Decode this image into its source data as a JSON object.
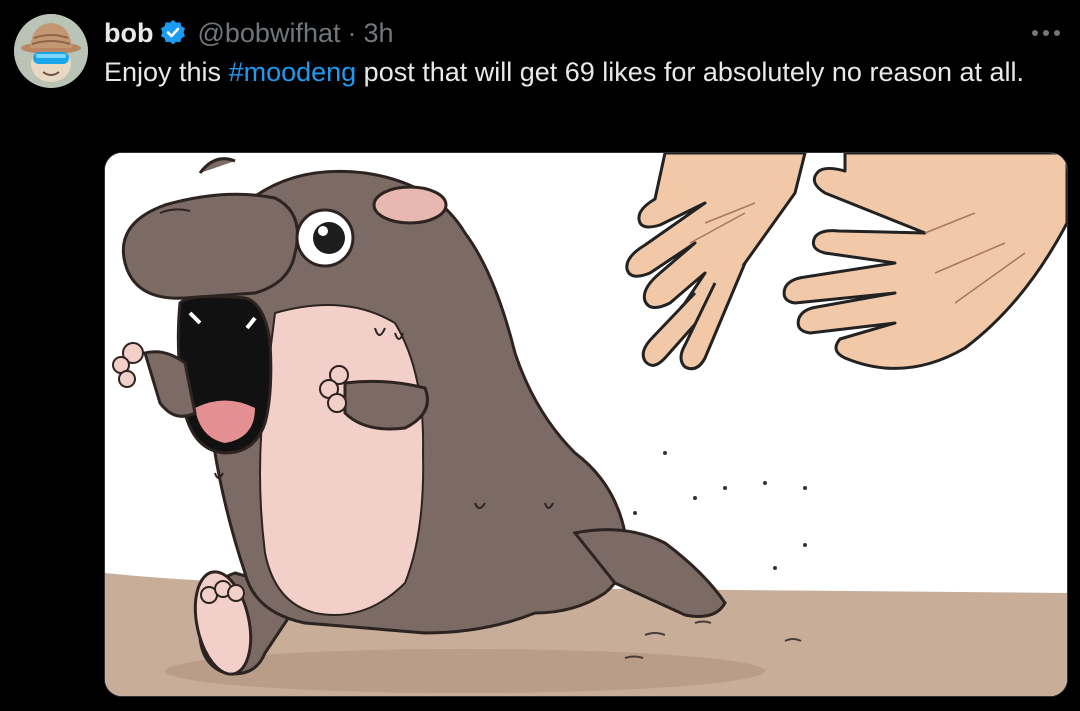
{
  "tweet": {
    "author": {
      "display_name": "bob",
      "handle": "@bobwifhat",
      "verified": true,
      "avatar_icon": "avatar-hat-goggles-icon"
    },
    "separator": "·",
    "time": "3h",
    "text_before": "Enjoy this ",
    "hashtag": "#moodeng",
    "text_after": " post that will get 69 likes for absolutely no reason at all.",
    "more_icon": "more-dots-icon",
    "media": {
      "icon": "hippo-running-illustration",
      "colors": {
        "hippo_body": "#7c6a64",
        "hippo_belly": "#f2cfc8",
        "ground": "#c8ad99",
        "hands": "#f2c9a8"
      }
    }
  },
  "colors": {
    "background": "#000000",
    "text": "#e7e9ea",
    "secondary": "#71767b",
    "accent": "#1d9bf0"
  }
}
